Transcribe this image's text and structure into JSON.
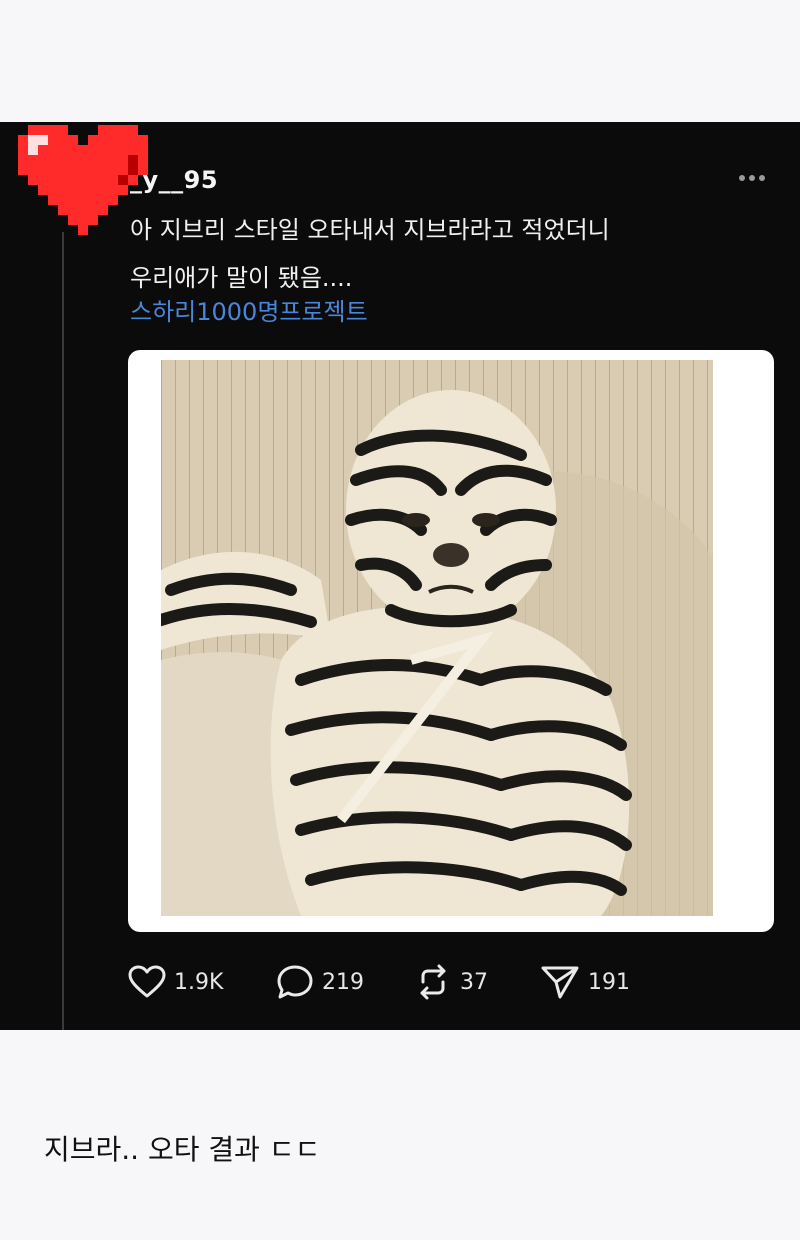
{
  "post": {
    "username": "_y__95",
    "more_icon": "more-horizontal-icon",
    "text_lines": [
      "아 지브리 스타일 오타내서 지브라라고 적었더니",
      "우리애가 말이 됐음...."
    ],
    "hashtag": "스하리1000명프로젝트",
    "image_alt": "baby illustrated with zebra stripes in pencil style",
    "actions": {
      "likes": "1.9K",
      "replies": "219",
      "reposts": "37",
      "shares": "191"
    },
    "avatar_icon": "pixel-heart-icon"
  },
  "caption": "지브라.. 오타 결과 ㄷㄷ",
  "colors": {
    "post_bg": "#0b0b0b",
    "page_bg": "#f7f7f9",
    "hashtag": "#4a86d8",
    "heart": "#ff2a2a"
  }
}
